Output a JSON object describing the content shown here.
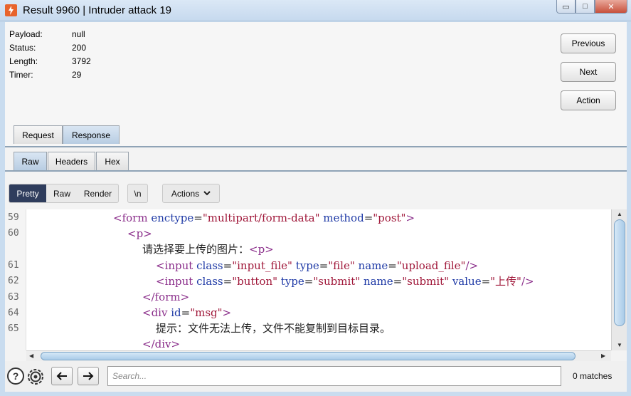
{
  "window": {
    "title": "Result 9960 | Intruder attack 19",
    "controls": {
      "minimize": "▭",
      "maximize": "□",
      "close": "✕"
    }
  },
  "info": {
    "payload_label": "Payload:",
    "payload_value": "null",
    "status_label": "Status:",
    "status_value": "200",
    "length_label": "Length:",
    "length_value": "3792",
    "timer_label": "Timer:",
    "timer_value": "29"
  },
  "side_buttons": {
    "previous": "Previous",
    "next": "Next",
    "action": "Action"
  },
  "main_tabs": {
    "request": "Request",
    "response": "Response",
    "active": "Response"
  },
  "sub_tabs": {
    "raw": "Raw",
    "headers": "Headers",
    "hex": "Hex",
    "active": "Raw"
  },
  "toolbar": {
    "pretty": "Pretty",
    "raw": "Raw",
    "render": "Render",
    "newline": "\\n",
    "actions": "Actions",
    "active": "Pretty"
  },
  "code": {
    "line_numbers": [
      "59",
      "60",
      "61",
      "62",
      "63",
      "64",
      "65"
    ],
    "lines": [
      {
        "tag_open": "<form ",
        "a1": "enctype",
        "eq1": "=",
        "v1": "\"multipart/form-data\"",
        "a2": " method",
        "eq2": "=",
        "v2": "\"post\"",
        "tag_close": ">"
      },
      {
        "tag": "<p>"
      },
      {
        "text": "请选择要上传的图片：",
        "tag": "<p>"
      },
      {
        "tag_open": "<input ",
        "a1": "class",
        "v1": "\"input_file\"",
        "a2": " type",
        "v2": "\"file\"",
        "a3": " name",
        "v3": "\"upload_file\"",
        "tag_close": "/>"
      },
      {
        "tag_open": "<input ",
        "a1": "class",
        "v1": "\"button\"",
        "a2": " type",
        "v2": "\"submit\"",
        "a3": " name",
        "v3": "\"submit\"",
        "a4": " value",
        "v4": "\"上传\"",
        "tag_close": "/>"
      },
      {
        "tag": "</form>"
      },
      {
        "tag_open": "<div ",
        "a1": "id",
        "v1": "\"msg\"",
        "tag_close": ">"
      },
      {
        "text": "提示：文件无法上传，文件不能复制到目标目录。"
      },
      {
        "tag": "</div>"
      }
    ]
  },
  "bottom": {
    "help_icon": "?",
    "search_placeholder": "Search...",
    "matches": "0 matches"
  },
  "colors": {
    "accent": "#2f3d5d",
    "tag": "#8a2d8a",
    "attr": "#1f3aa6",
    "value": "#a0183a"
  }
}
